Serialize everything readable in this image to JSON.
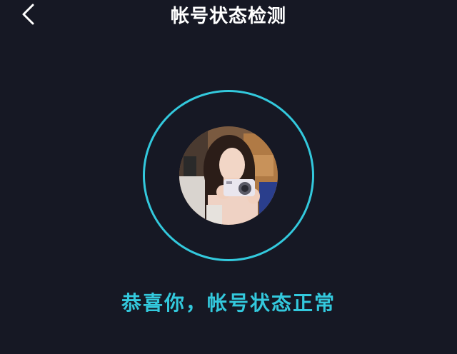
{
  "header": {
    "title": "帐号状态检测",
    "back_icon": "chevron-left-icon"
  },
  "detection": {
    "avatar_alt": "用户头像",
    "status_message": "恭喜你，帐号状态正常"
  },
  "colors": {
    "background": "#161824",
    "accent": "#33c9dd",
    "title": "#ffffff"
  }
}
